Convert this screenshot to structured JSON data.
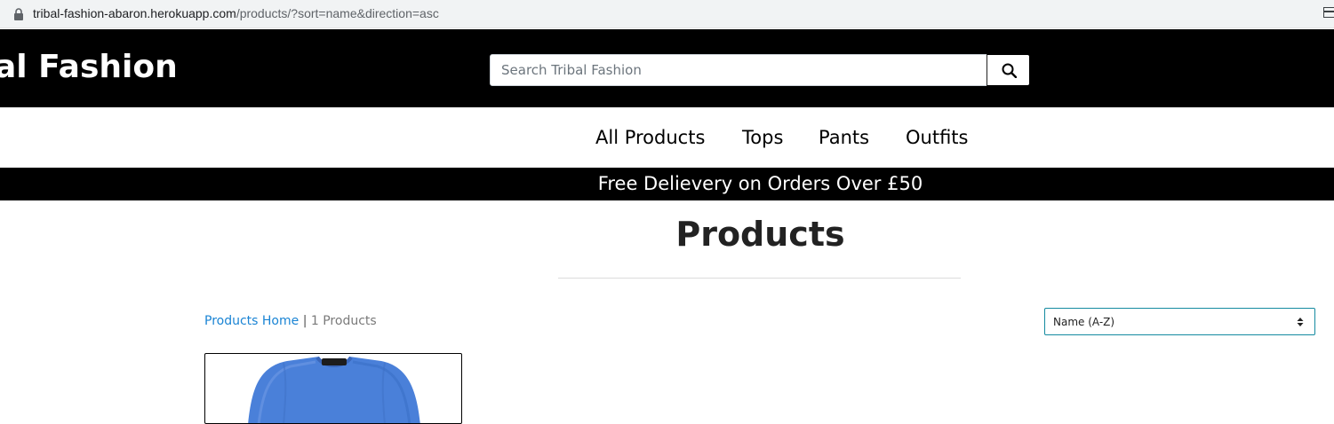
{
  "browser": {
    "url_domain": "tribal-fashion-abaron.herokuapp.com",
    "url_path": "/products/?sort=name&direction=asc"
  },
  "header": {
    "brand": "al Fashion",
    "search_placeholder": "Search Tribal Fashion",
    "search_icon": "magnifier"
  },
  "nav": {
    "items": [
      {
        "label": "All Products"
      },
      {
        "label": "Tops"
      },
      {
        "label": "Pants"
      },
      {
        "label": "Outfits"
      }
    ]
  },
  "banner": {
    "text": "Free Delievery on Orders Over £50"
  },
  "page": {
    "title": "Products",
    "breadcrumb_link": "Products Home",
    "breadcrumb_separator": "|",
    "product_count": "1 Products",
    "sort_selected": "Name (A-Z)"
  },
  "products": [
    {
      "image": "blue-athletic-t-shirt"
    }
  ],
  "colors": {
    "header_bg": "#000000",
    "link_blue": "#1a84d4",
    "select_border": "#148aa0",
    "shirt_blue": "#4a80d9"
  }
}
